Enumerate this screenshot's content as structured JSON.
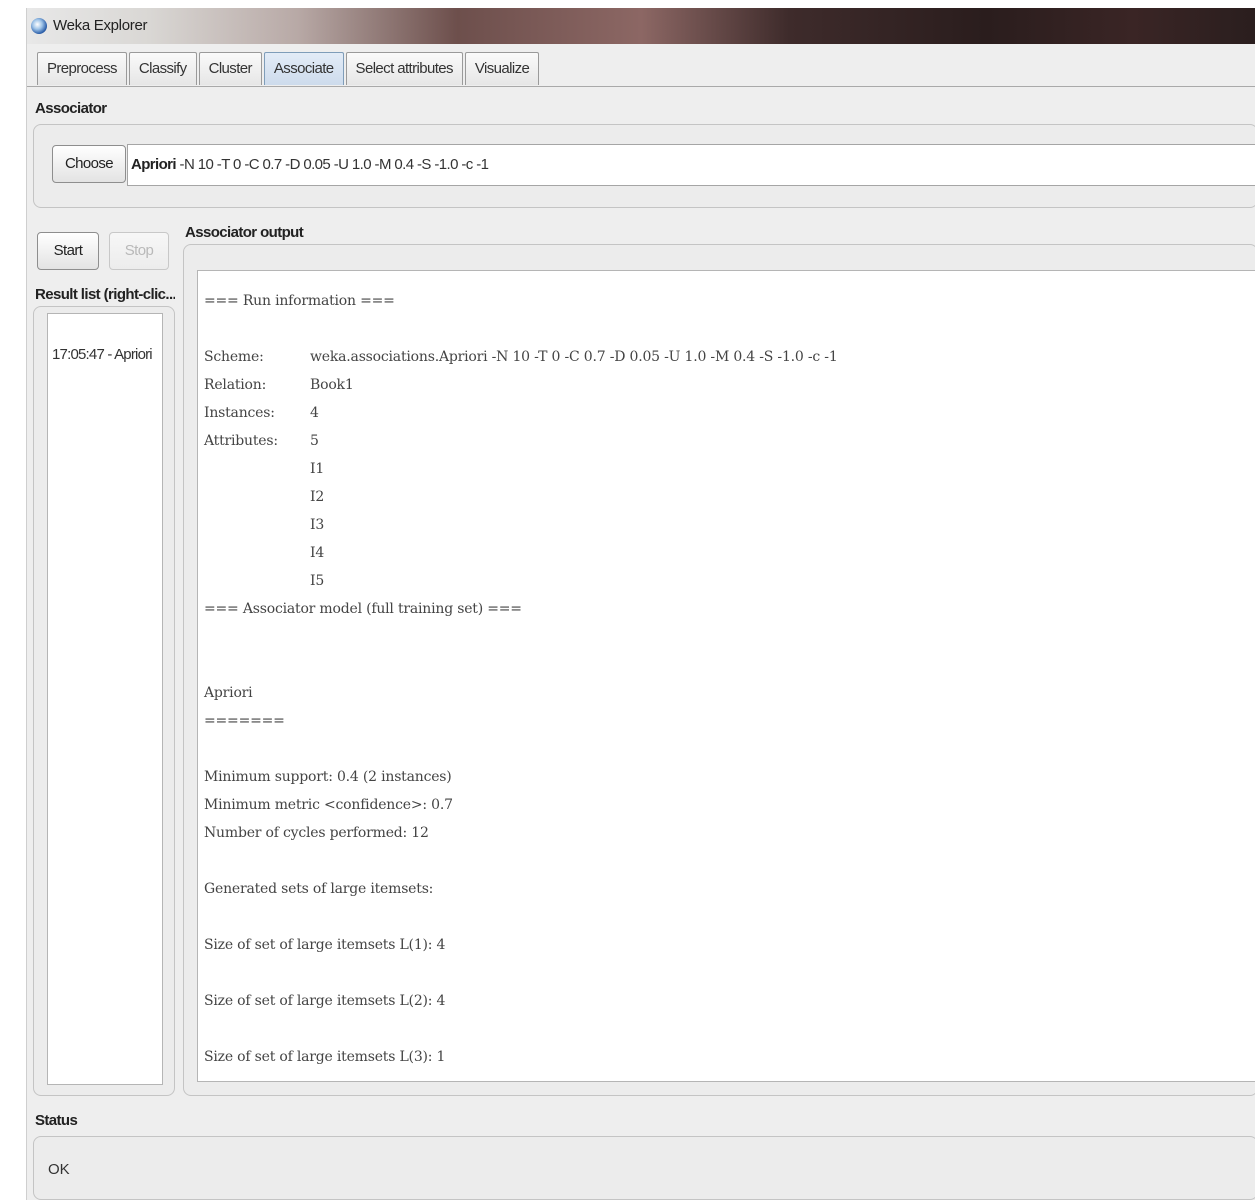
{
  "window": {
    "title": "Weka Explorer"
  },
  "tabs": [
    {
      "label": "Preprocess"
    },
    {
      "label": "Classify"
    },
    {
      "label": "Cluster"
    },
    {
      "label": "Associate"
    },
    {
      "label": "Select attributes"
    },
    {
      "label": "Visualize"
    }
  ],
  "active_tab": "Associate",
  "associator": {
    "section_label": "Associator",
    "choose_label": "Choose",
    "scheme_name": "Apriori",
    "scheme_options": "-N 10 -T 0 -C 0.7 -D 0.05 -U 1.0 -M 0.4 -S -1.0 -c -1"
  },
  "controls": {
    "start_label": "Start",
    "stop_label": "Stop"
  },
  "result_list": {
    "label": "Result list (right-clic...",
    "items": [
      "17:05:47 - Apriori"
    ]
  },
  "output": {
    "label": "Associator output",
    "lines": [
      {
        "text": "=== Run information ==="
      },
      {
        "text": ""
      },
      {
        "key": "Scheme:",
        "value": "weka.associations.Apriori -N 10 -T 0 -C 0.7 -D 0.05 -U 1.0 -M 0.4 -S -1.0 -c -1"
      },
      {
        "key": "Relation:",
        "value": "Book1"
      },
      {
        "key": "Instances:",
        "value": "4"
      },
      {
        "key": "Attributes:",
        "value": "5"
      },
      {
        "key": "",
        "value": "I1"
      },
      {
        "key": "",
        "value": "I2"
      },
      {
        "key": "",
        "value": "I3"
      },
      {
        "key": "",
        "value": "I4"
      },
      {
        "key": "",
        "value": "I5"
      },
      {
        "text": "=== Associator model (full training set) ==="
      },
      {
        "text": ""
      },
      {
        "text": ""
      },
      {
        "text": "Apriori"
      },
      {
        "text": "======="
      },
      {
        "text": ""
      },
      {
        "text": "Minimum support: 0.4 (2 instances)"
      },
      {
        "text": "Minimum metric <confidence>: 0.7"
      },
      {
        "text": "Number of cycles performed: 12"
      },
      {
        "text": ""
      },
      {
        "text": "Generated sets of large itemsets:"
      },
      {
        "text": ""
      },
      {
        "text": "Size of set of large itemsets L(1): 4"
      },
      {
        "text": ""
      },
      {
        "text": "Size of set of large itemsets L(2): 4"
      },
      {
        "text": ""
      },
      {
        "text": "Size of set of large itemsets L(3): 1"
      }
    ]
  },
  "status": {
    "label": "Status",
    "text": "OK"
  }
}
